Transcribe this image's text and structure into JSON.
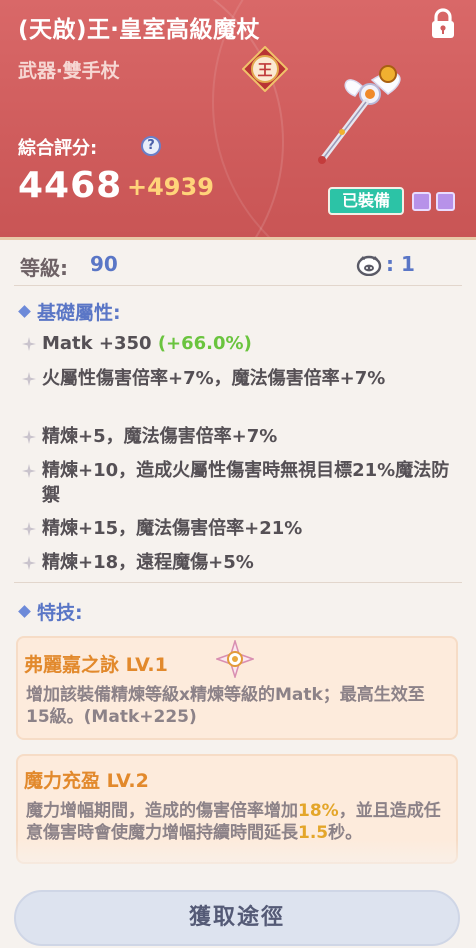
{
  "item": {
    "title": "(天啟)王‧皇室高級魔杖",
    "type": "武器‧雙手杖",
    "emblem_text": "王",
    "score_label": "綜合評分:",
    "score": "4468",
    "score_bonus": "+4939",
    "equipped_label": "已裝備"
  },
  "level": {
    "label": "等級:",
    "value": "90",
    "pig_value": ": 1"
  },
  "base_attributes": {
    "title": "基礎屬性:",
    "lines": [
      {
        "main": "Matk +350 ",
        "extra": "(+66.0%)"
      },
      {
        "main": "火屬性傷害倍率+7%，魔法傷害倍率+7%"
      },
      {
        "main": "精煉+5，魔法傷害倍率+7%"
      },
      {
        "main": "精煉+10，造成火屬性傷害時無視目標21%魔法防禦"
      },
      {
        "main": "精煉+15，魔法傷害倍率+21%"
      },
      {
        "main": "精煉+18，遠程魔傷+5%"
      }
    ]
  },
  "skills": {
    "title": "特技:",
    "items": [
      {
        "name": "弗麗嘉之詠 LV.1",
        "desc": "增加該裝備精煉等級x精煉等級的Matk；最高生效至15級。(Matk+225)"
      },
      {
        "name": "魔力充盈 LV.2",
        "desc_a": "魔力增幅期間，造成的傷害倍率增加",
        "desc_b": "18%",
        "desc_c": "，並且造成任意傷害時會使魔力增幅持續時間延長",
        "desc_d": "1.5",
        "desc_e": "秒。"
      }
    ]
  },
  "button": {
    "label": "獲取途徑"
  },
  "colors": {
    "header": "#d96868",
    "accent_blue": "#5a76c6",
    "equipped": "#2cc3a6",
    "skill_name": "#e2892c"
  },
  "icons": [
    "lock-icon",
    "emblem-icon",
    "weapon-staff-icon",
    "help-icon",
    "pig-icon",
    "star-bullet-icon",
    "diamond-bullet-icon",
    "skill-badge-icon"
  ]
}
